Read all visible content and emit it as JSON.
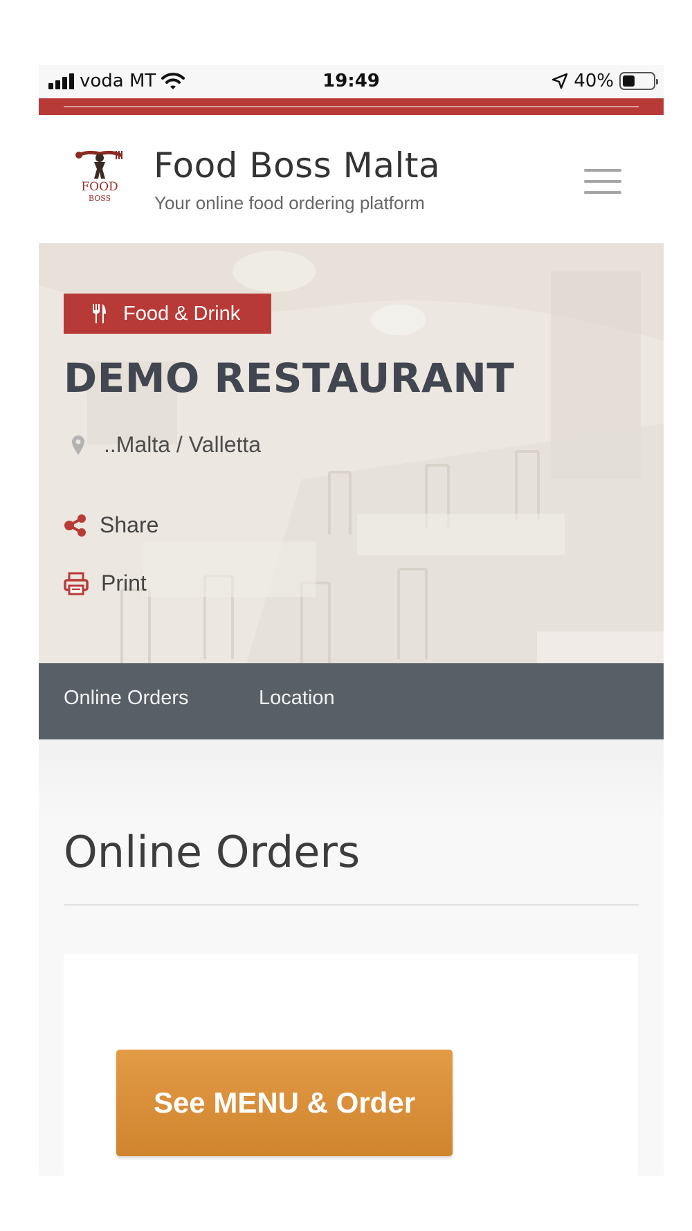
{
  "status_bar": {
    "carrier": "voda MT",
    "time": "19:49",
    "battery": "40%",
    "battery_level": 0.4
  },
  "header": {
    "logo_text_main": "FOOD",
    "logo_text_sub": "BOSS",
    "site_title": "Food Boss Malta",
    "tagline": "Your online food ordering platform",
    "menu_icon": "hamburger-icon"
  },
  "hero": {
    "category": "Food & Drink",
    "category_icon": "fork-knife-icon",
    "restaurant_name": "DEMO RESTAURANT",
    "location": "..Malta / Valletta",
    "location_icon": "map-pin-icon",
    "share_label": "Share",
    "print_label": "Print"
  },
  "tabs": [
    {
      "label": "Online Orders"
    },
    {
      "label": "Location"
    }
  ],
  "content": {
    "section_title": "Online Orders",
    "order_button": "See MENU & Order"
  },
  "colors": {
    "brand_red": "#b83a37",
    "tab_bar": "#595f67",
    "order_button": "#d98d38",
    "heading_text": "#414650"
  }
}
